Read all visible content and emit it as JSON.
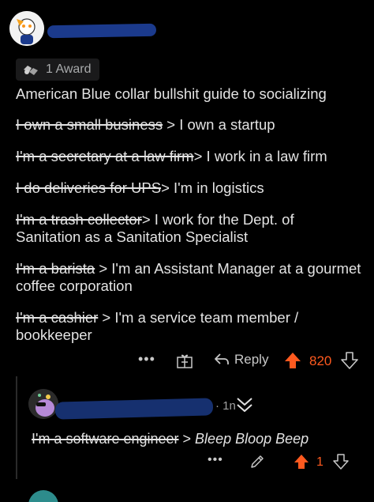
{
  "award": {
    "label": "1 Award"
  },
  "comment": {
    "title": "American Blue collar bullshit guide to socializing",
    "lines": [
      {
        "struck": "I own a small business",
        "rest": " > I own a startup"
      },
      {
        "struck": "I'm a secretary at a law firm",
        "rest": "> I work in a law firm"
      },
      {
        "struck": "I do deliveries for UPS",
        "rest": "> I'm in logistics"
      },
      {
        "struck": "I'm a trash collector",
        "rest": "> I work for the Dept. of Sanitation as a Sanitation Specialist"
      },
      {
        "struck": "I'm a barista",
        "rest": " > I'm an Assistant Manager at a gourmet coffee corporation"
      },
      {
        "struck": "I'm a cashier",
        "rest": " > I'm a service team member / bookkeeper"
      }
    ],
    "more": "•••",
    "reply_label": "Reply",
    "score": "820"
  },
  "reply": {
    "time": "· 1n",
    "struck": "I'm a software engineer",
    "sep": " > ",
    "rest": "Bleep Bloop Beep",
    "more": "•••",
    "score": "1"
  },
  "colors": {
    "upvote": "#ff5a1f",
    "background": "#000000",
    "text": "#e3e3e3",
    "redaction": "#1b3a8c"
  }
}
